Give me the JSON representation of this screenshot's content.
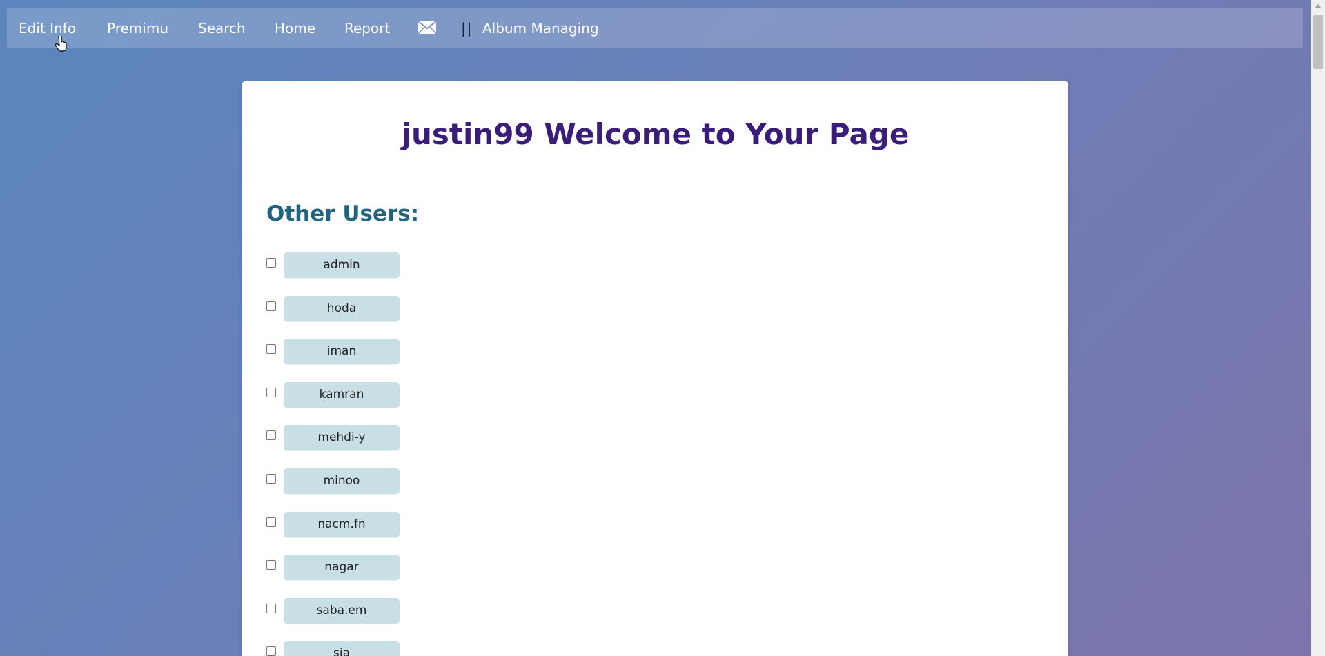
{
  "nav": {
    "edit_info": "Edit Info",
    "premimu": "Premimu",
    "search": "Search",
    "home": "Home",
    "report": "Report",
    "mail_icon": "envelope-icon",
    "separator": "||",
    "album_managing": "Album Managing"
  },
  "main": {
    "title": "justin99 Welcome to Your Page",
    "section_title": "Other Users:",
    "users": [
      "admin",
      "hoda",
      "iman",
      "kamran",
      "mehdi-y",
      "minoo",
      "nacm.fn",
      "nagar",
      "saba.em",
      "sia"
    ]
  },
  "colors": {
    "title": "#3a1d7a",
    "section_title": "#1f6480",
    "user_button": "#c8dfe5"
  }
}
